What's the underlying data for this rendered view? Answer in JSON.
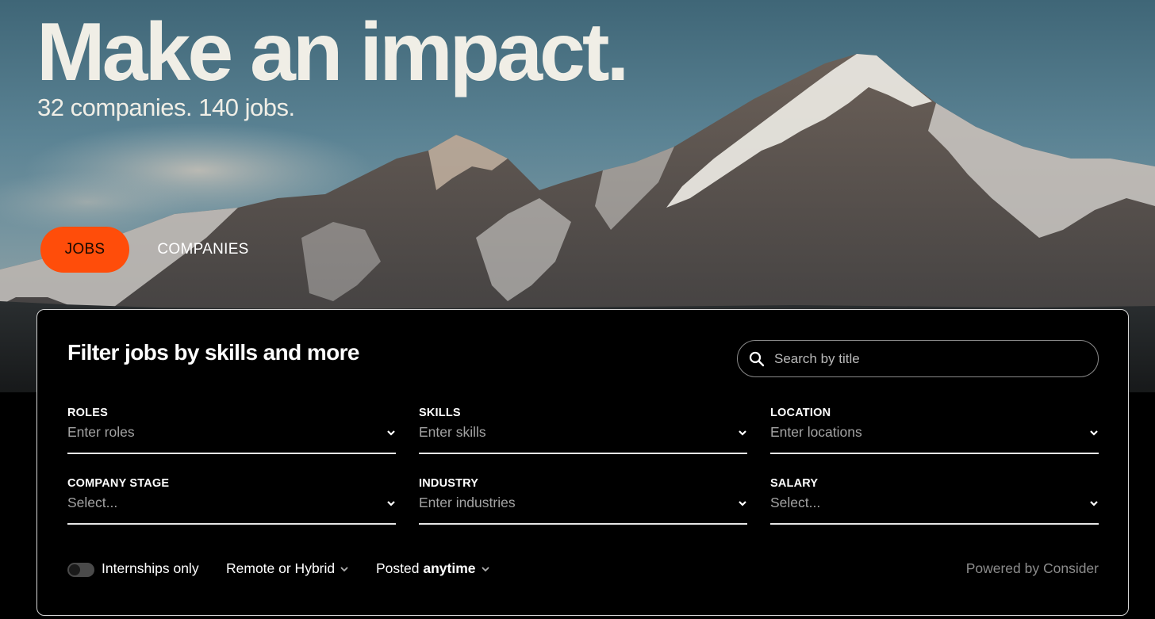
{
  "hero": {
    "title": "Make an impact.",
    "subtitle": "32 companies. 140 jobs."
  },
  "tabs": [
    {
      "label": "JOBS",
      "active": true
    },
    {
      "label": "COMPANIES",
      "active": false
    }
  ],
  "filters": {
    "heading": "Filter jobs by skills and more",
    "search": {
      "placeholder": "Search by title",
      "icon": "search-icon"
    },
    "fields": [
      {
        "label": "ROLES",
        "placeholder": "Enter roles"
      },
      {
        "label": "SKILLS",
        "placeholder": "Enter skills"
      },
      {
        "label": "LOCATION",
        "placeholder": "Enter locations"
      },
      {
        "label": "COMPANY STAGE",
        "placeholder": "Select..."
      },
      {
        "label": "INDUSTRY",
        "placeholder": "Enter industries"
      },
      {
        "label": "SALARY",
        "placeholder": "Select..."
      }
    ],
    "internships": {
      "label": "Internships only",
      "enabled": false
    },
    "work_type": {
      "label": "Remote or Hybrid"
    },
    "posted": {
      "prefix": "Posted",
      "value": "anytime"
    },
    "powered_by": "Powered by Consider"
  },
  "colors": {
    "accent": "#ff4d0a",
    "panel_bg": "#000000",
    "panel_border": "#d6d6d6",
    "hero_text": "#f0eee6"
  }
}
